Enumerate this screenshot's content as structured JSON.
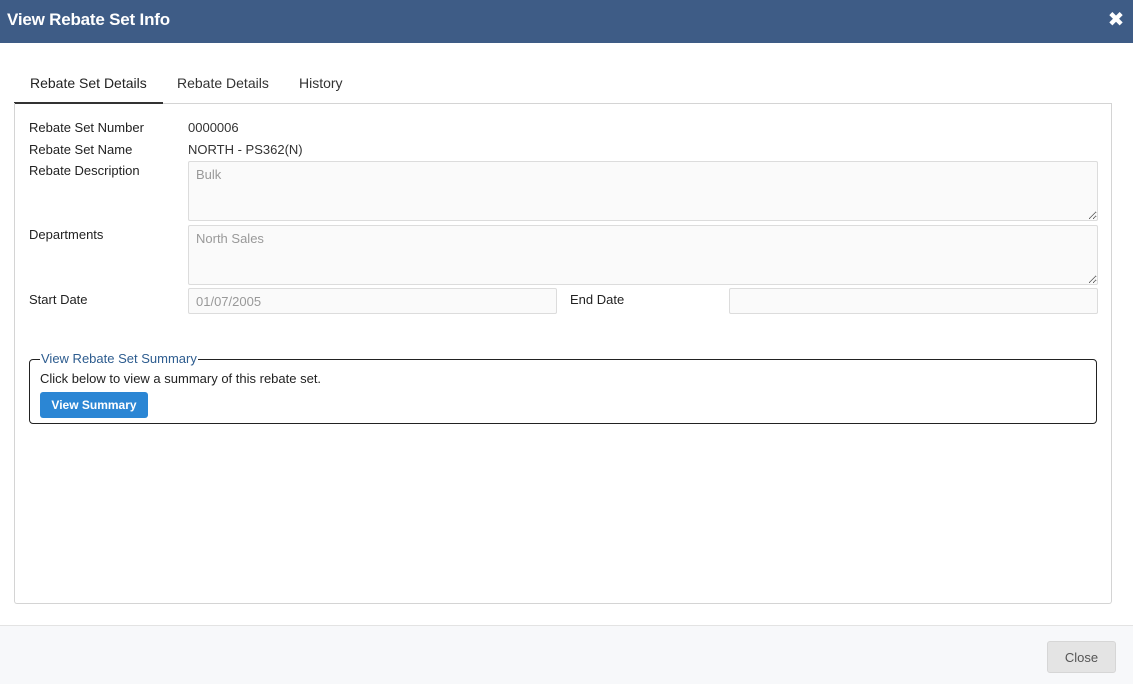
{
  "dialog": {
    "title": "View Rebate Set Info",
    "close_icon": "close-icon"
  },
  "tabs": [
    {
      "label": "Rebate Set Details",
      "active": true
    },
    {
      "label": "Rebate Details",
      "active": false
    },
    {
      "label": "History",
      "active": false
    }
  ],
  "details": {
    "rebate_set_number_label": "Rebate Set Number",
    "rebate_set_number": "0000006",
    "rebate_set_name_label": "Rebate Set Name",
    "rebate_set_name": "NORTH - PS362(N)",
    "rebate_description_label": "Rebate Description",
    "rebate_description": "Bulk",
    "departments_label": "Departments",
    "departments": "North Sales",
    "start_date_label": "Start Date",
    "start_date": "01/07/2005",
    "end_date_label": "End Date",
    "end_date": ""
  },
  "summary": {
    "legend": "View Rebate Set Summary",
    "text": "Click below to view a summary of this rebate set.",
    "button_label": "View Summary"
  },
  "footer": {
    "close_label": "Close"
  },
  "colors": {
    "titlebar": "#3e5c86",
    "primary_button": "#2b86d4",
    "legend_text": "#2d5c8f"
  }
}
